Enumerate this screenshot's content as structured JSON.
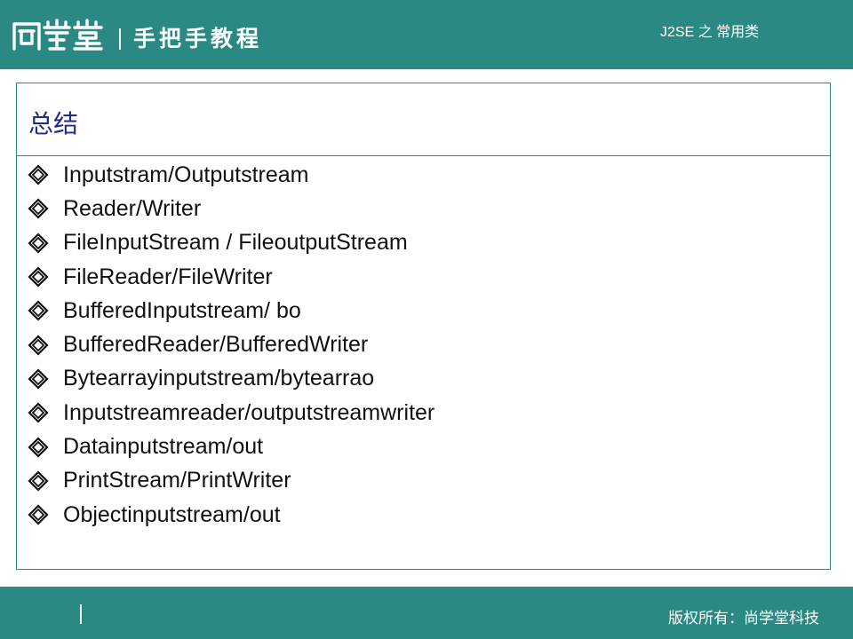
{
  "header": {
    "logo_text": "尚学堂",
    "tagline": "手把手教程",
    "course_title": "J2SE 之 常用类"
  },
  "slide": {
    "title": "总结",
    "bullets": [
      "Inputstram/Outputstream",
      "Reader/Writer",
      "FileInputStream / FileoutputStream",
      "FileReader/FileWriter",
      "BufferedInputstream/ bo",
      "BufferedReader/BufferedWriter",
      "Bytearrayinputstream/bytearrao",
      "Inputstreamreader/outputstreamwriter",
      "Datainputstream/out",
      "PrintStream/PrintWriter",
      "Objectinputstream/out"
    ]
  },
  "footer": {
    "copyright": "版权所有：尚学堂科技"
  },
  "colors": {
    "accent": "#2a8a83",
    "title": "#1f2a8a",
    "bullet": "#111111"
  },
  "icons": {
    "bullet": "diamond-bullet-icon",
    "logo": "shangxuetang-logo"
  }
}
